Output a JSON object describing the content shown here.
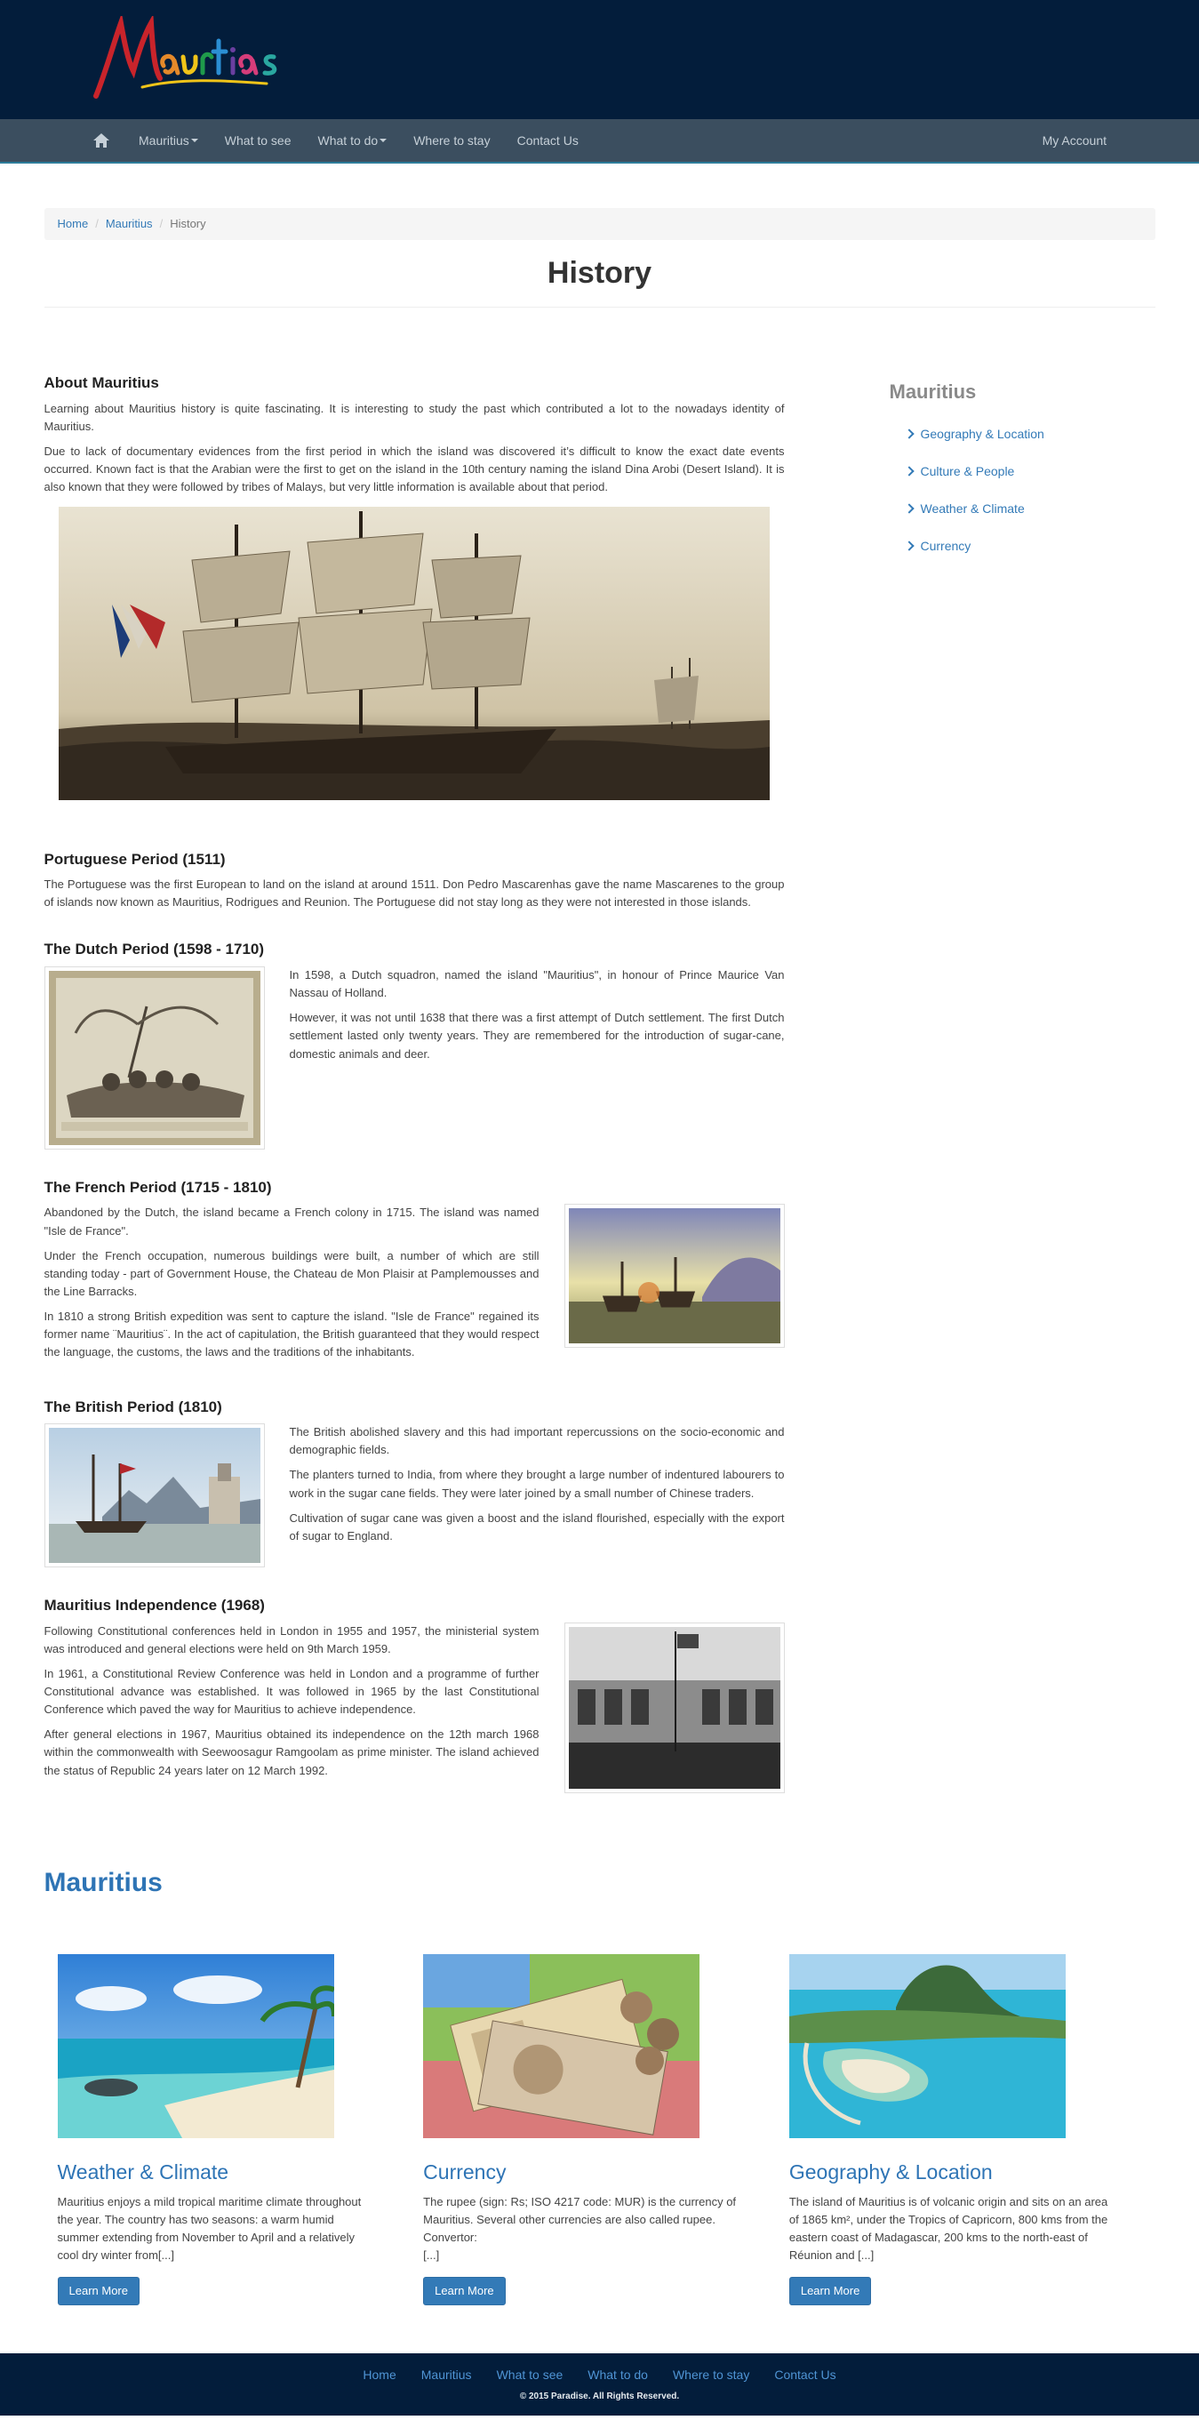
{
  "header": {
    "logo_text": "Mauritius"
  },
  "nav": {
    "items": [
      {
        "label": "Mauritius",
        "dropdown": true
      },
      {
        "label": "What to see",
        "dropdown": false
      },
      {
        "label": "What to do",
        "dropdown": true
      },
      {
        "label": "Where to stay",
        "dropdown": false
      },
      {
        "label": "Contact Us",
        "dropdown": false
      }
    ],
    "account": "My Account"
  },
  "breadcrumb": {
    "home": "Home",
    "section": "Mauritius",
    "current": "History"
  },
  "page_title": "History",
  "sidebar": {
    "title": "Mauritius",
    "links": [
      "Geography & Location",
      "Culture & People",
      "Weather & Climate",
      "Currency"
    ]
  },
  "about": {
    "title": "About Mauritius",
    "p1": "Learning about Mauritius history is quite fascinating. It is interesting to study the past which contributed a lot to the nowadays identity of Mauritius.",
    "p2": "Due to lack of documentary evidences from the first period in which the island was discovered it’s difficult to know the exact date events occurred. Known fact is that the Arabian were the first to get on the island in the 10th century naming the island Dina Arobi (Desert Island). It is also known that they were followed by tribes of Malays, but very little information is available about that period."
  },
  "portuguese": {
    "title": "Portuguese Period (1511)",
    "p1": "The Portuguese was the first European to land on the island at around 1511. Don Pedro Mascarenhas gave the name Mascarenes to the group of islands now known as Mauritius, Rodrigues and Reunion. The Portuguese did not stay long as they were not interested in those islands."
  },
  "dutch": {
    "title": "The Dutch Period (1598 - 1710)",
    "p1": "In 1598, a Dutch squadron, named the island \"Mauritius\", in honour of Prince Maurice Van Nassau of Holland.",
    "p2": "However, it was not until 1638 that there was a first attempt of Dutch settlement. The first Dutch settlement lasted only twenty years. They are remembered for the introduction of sugar-cane, domestic animals and deer."
  },
  "french": {
    "title": "The French Period (1715 - 1810)",
    "p1": "Abandoned by the Dutch, the island became a French colony in 1715. The island was named \"Isle de France\".",
    "p2": "Under the French occupation, numerous buildings were built, a number of which are still standing today - part of Government House, the Chateau de Mon Plaisir at Pamplemousses and the Line Barracks.",
    "p3": "In 1810 a strong British expedition was sent to capture the island. \"Isle de France\" regained its former name ¨Mauritius¨. In the act of capitulation, the British guaranteed that they would respect the language, the customs, the laws and the traditions of the inhabitants."
  },
  "british": {
    "title": "The British Period (1810)",
    "p1": "The British abolished slavery and this had important repercussions on the socio-economic and demographic fields.",
    "p2": "The planters turned to India, from where they brought a large number of indentured labourers to work in the sugar cane fields. They were later joined by a small number of Chinese traders.",
    "p3": "Cultivation of sugar cane was given a boost and the island flourished, especially with the export of sugar to England."
  },
  "independence": {
    "title": "Mauritius Independence (1968)",
    "p1": "Following Constitutional conferences held in London in 1955 and 1957, the ministerial system was introduced and general elections were held on 9th March 1959.",
    "p2": "In 1961, a Constitutional Review Conference was held in London and a programme of further Constitutional advance was established. It was followed in 1965 by the last Constitutional Conference which paved the way for Mauritius to achieve independence.",
    "p3": "After general elections in 1967, Mauritius obtained its independence on the 12th march 1968 within the commonwealth with Seewoosagur Ramgoolam as prime minister. The island achieved the status of Republic 24 years later on 12 March 1992."
  },
  "featured": {
    "title": "Mauritius",
    "cards": [
      {
        "title": "Weather & Climate",
        "text": "Mauritius enjoys a mild tropical maritime climate throughout the year. The country has two seasons: a warm humid summer extending from November to April and a relatively cool dry winter from[...]",
        "button": "Learn More"
      },
      {
        "title": "Currency",
        "text": "The rupee (sign: Rs; ISO 4217 code: MUR) is the currency of Mauritius. Several other currencies are also called rupee. Convertor:",
        "text2": "[...]",
        "button": "Learn More"
      },
      {
        "title": "Geography & Location",
        "text": "The island of Mauritius is of volcanic origin and sits on an area of 1865 km², under the Tropics of Capricorn, 800 kms from the eastern coast of Madagascar, 200 kms to the north-east of Réunion and [...]",
        "button": "Learn More"
      }
    ]
  },
  "footer": {
    "links": [
      "Home",
      "Mauritius",
      "What to see",
      "What to do",
      "Where to stay",
      "Contact Us"
    ],
    "copyright": "© 2015 Paradise. All Rights Reserved."
  }
}
